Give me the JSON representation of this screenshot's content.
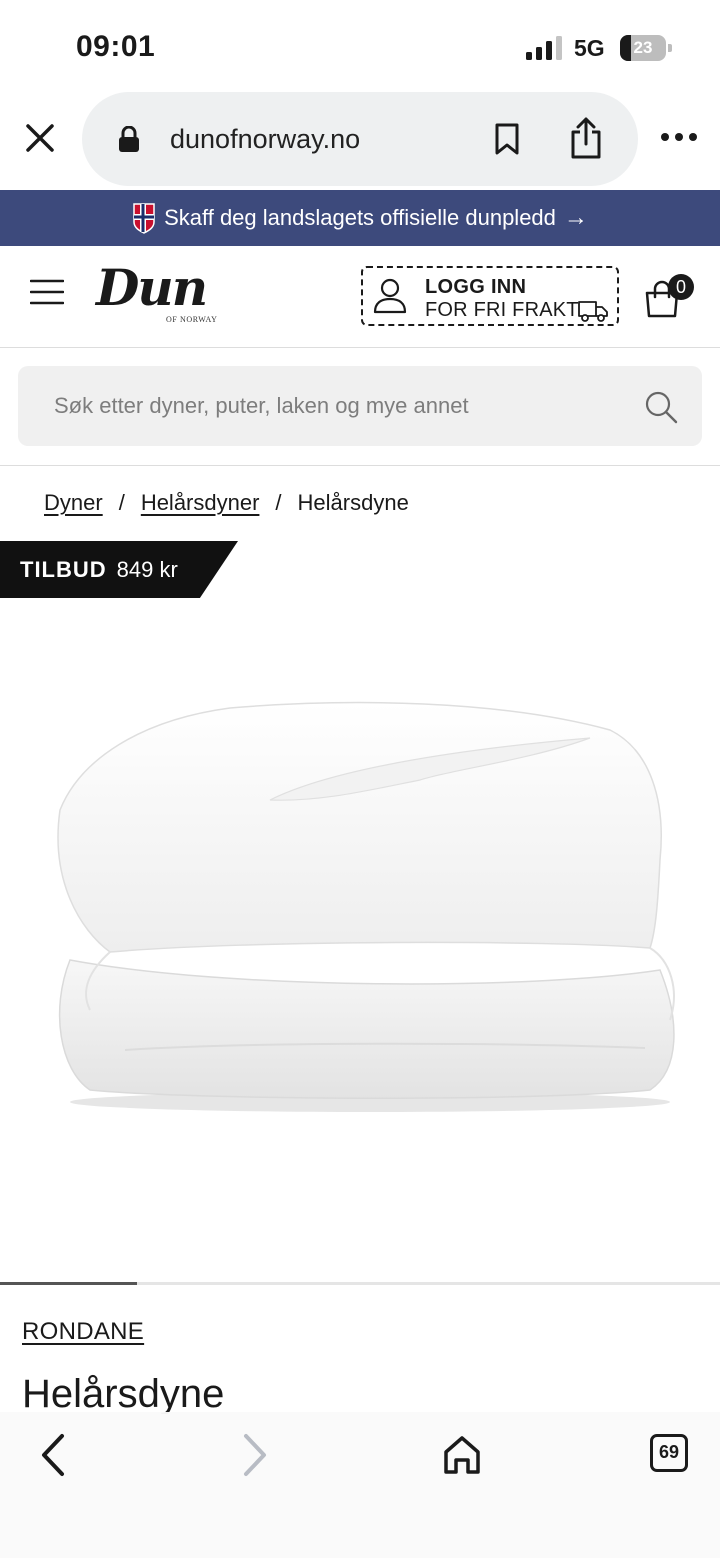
{
  "status_bar": {
    "time": "09:01",
    "network": "5G",
    "battery": "23",
    "battery_level": 0.23,
    "signal_bars": 3
  },
  "browser": {
    "url": "dunofnorway.no",
    "tab_count": "69"
  },
  "promo": {
    "text": "Skaff deg landslagets offisielle dunpledd",
    "arrow": "→"
  },
  "header": {
    "logo_text": "Dun",
    "logo_subtext": "OF NORWAY",
    "login_title": "LOGG INN",
    "login_subtitle": "FOR FRI FRAKT",
    "cart_count": "0"
  },
  "search": {
    "placeholder": "Søk etter dyner, puter, laken og mye annet"
  },
  "breadcrumb": {
    "items": [
      "Dyner",
      "Helårsdyner"
    ],
    "separator": "/",
    "current": "Helårsdyne"
  },
  "product": {
    "sale_label": "TILBUD",
    "price": "849 kr",
    "brand": "RONDANE",
    "title": "Helårsdyne",
    "carousel_progress": 0.19
  },
  "colors": {
    "promo_background": "#3d4a7c",
    "sale_tag": "#111111",
    "search_background": "#f0f0f0"
  },
  "icons": {
    "close": "close-icon",
    "lock": "lock-icon",
    "bookmark": "bookmark-icon",
    "share": "share-icon",
    "more": "more-icon",
    "flag": "norway-flag-icon",
    "menu": "menu-icon",
    "user": "user-icon",
    "truck": "truck-icon",
    "cart": "shopping-bag-icon",
    "search": "search-icon",
    "back": "back-icon",
    "forward": "forward-icon",
    "home": "home-icon",
    "tabs": "tabs-icon"
  }
}
